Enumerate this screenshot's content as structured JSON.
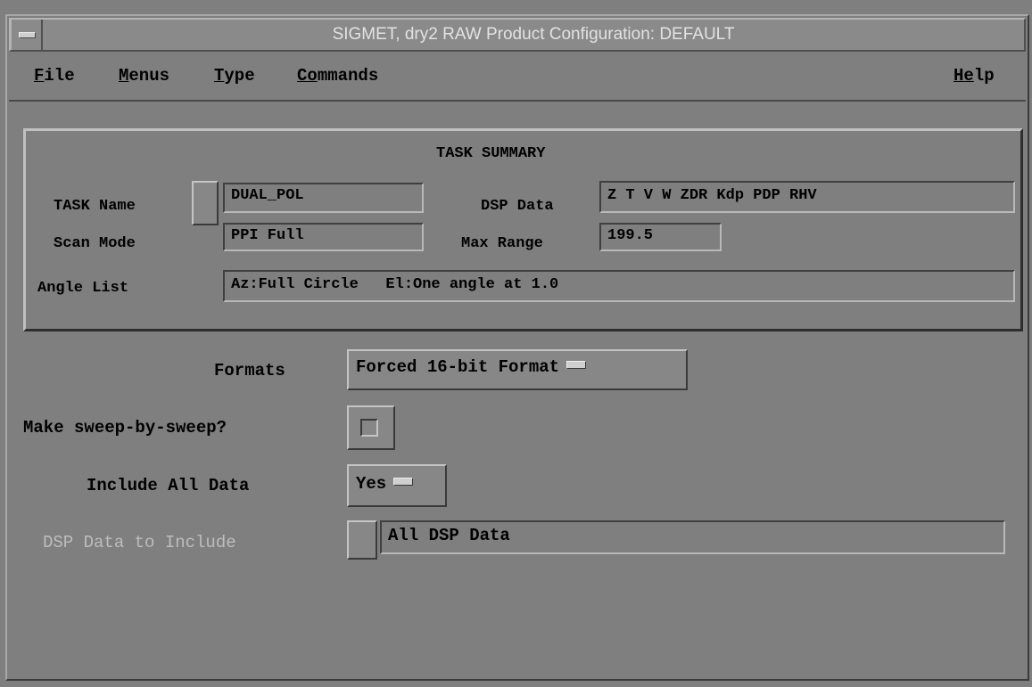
{
  "window": {
    "title": "SIGMET, dry2  RAW Product Configuration: DEFAULT"
  },
  "menubar": {
    "file": {
      "mnemonic": "F",
      "rest": "ile"
    },
    "menus": {
      "mnemonic": "M",
      "rest": "enus"
    },
    "type": {
      "mnemonic": "T",
      "rest": "ype"
    },
    "commands": {
      "mnemonic": "Co",
      "rest": "mmands"
    },
    "help": {
      "mnemonic": "He",
      "rest": "lp"
    }
  },
  "task_summary": {
    "title": "TASK SUMMARY",
    "task_name_label": "TASK Name",
    "task_name_value": "DUAL_POL",
    "scan_mode_label": "Scan Mode",
    "scan_mode_value": "PPI Full",
    "angle_list_label": "Angle List",
    "angle_list_value": "Az:Full Circle   El:One angle at 1.0",
    "dsp_data_label": "DSP Data",
    "dsp_data_value": "Z T V W ZDR Kdp PDP RHV",
    "max_range_label": "Max Range",
    "max_range_value": "199.5"
  },
  "settings": {
    "formats_label": "Formats",
    "formats_value": "Forced 16-bit Format",
    "sweep_label": "Make sweep-by-sweep?",
    "sweep_checked": false,
    "include_all_label": "Include All Data",
    "include_all_value": "Yes",
    "dsp_include_label": "DSP Data to Include",
    "dsp_include_value": "All DSP Data"
  }
}
